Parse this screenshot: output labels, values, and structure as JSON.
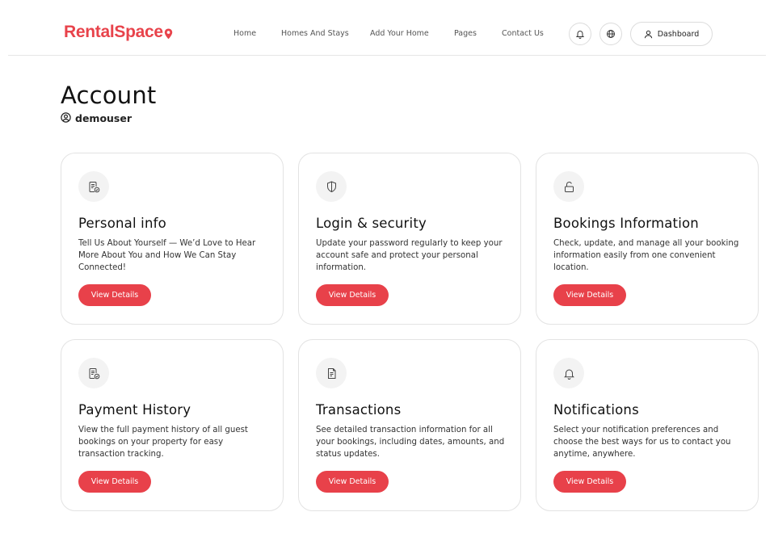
{
  "brand": {
    "name_first": "R",
    "name_rest": "entalSpace",
    "color": "#e8434b"
  },
  "nav": {
    "items": [
      "Home",
      "Homes And Stays",
      "Add Your Home",
      "Pages",
      "Contact Us"
    ]
  },
  "header_actions": {
    "notifications_icon": "bell-icon",
    "language_icon": "globe-icon",
    "dashboard_label": "Dashboard",
    "dashboard_icon": "user-icon"
  },
  "page": {
    "title": "Account",
    "username": "demouser"
  },
  "cards": [
    {
      "icon": "document-check-icon",
      "title": "Personal info",
      "description": "Tell Us About Yourself — We’d Love to Hear More About You and How We Can Stay Connected!",
      "button": "View Details"
    },
    {
      "icon": "shield-icon",
      "title": "Login & security",
      "description": "Update your password regularly to keep your account safe and protect your personal information.",
      "button": "View Details"
    },
    {
      "icon": "unlock-icon",
      "title": "Bookings Information",
      "description": "Check, update, and manage all your booking information easily from one convenient location.",
      "button": "View Details"
    },
    {
      "icon": "document-check-icon",
      "title": "Payment History",
      "description": "View the full payment history of all guest bookings on your property for easy transaction tracking.",
      "button": "View Details"
    },
    {
      "icon": "receipt-icon",
      "title": "Transactions",
      "description": "See detailed transaction information for all your bookings, including dates, amounts, and status updates.",
      "button": "View Details"
    },
    {
      "icon": "bell-icon",
      "title": "Notifications",
      "description": "Select your notification preferences and choose the best ways for us to contact you anytime, anywhere.",
      "button": "View Details"
    }
  ],
  "colors": {
    "accent": "#e8414a",
    "card_border": "#e3e3e3",
    "icon_bg": "#f3f3f3"
  }
}
